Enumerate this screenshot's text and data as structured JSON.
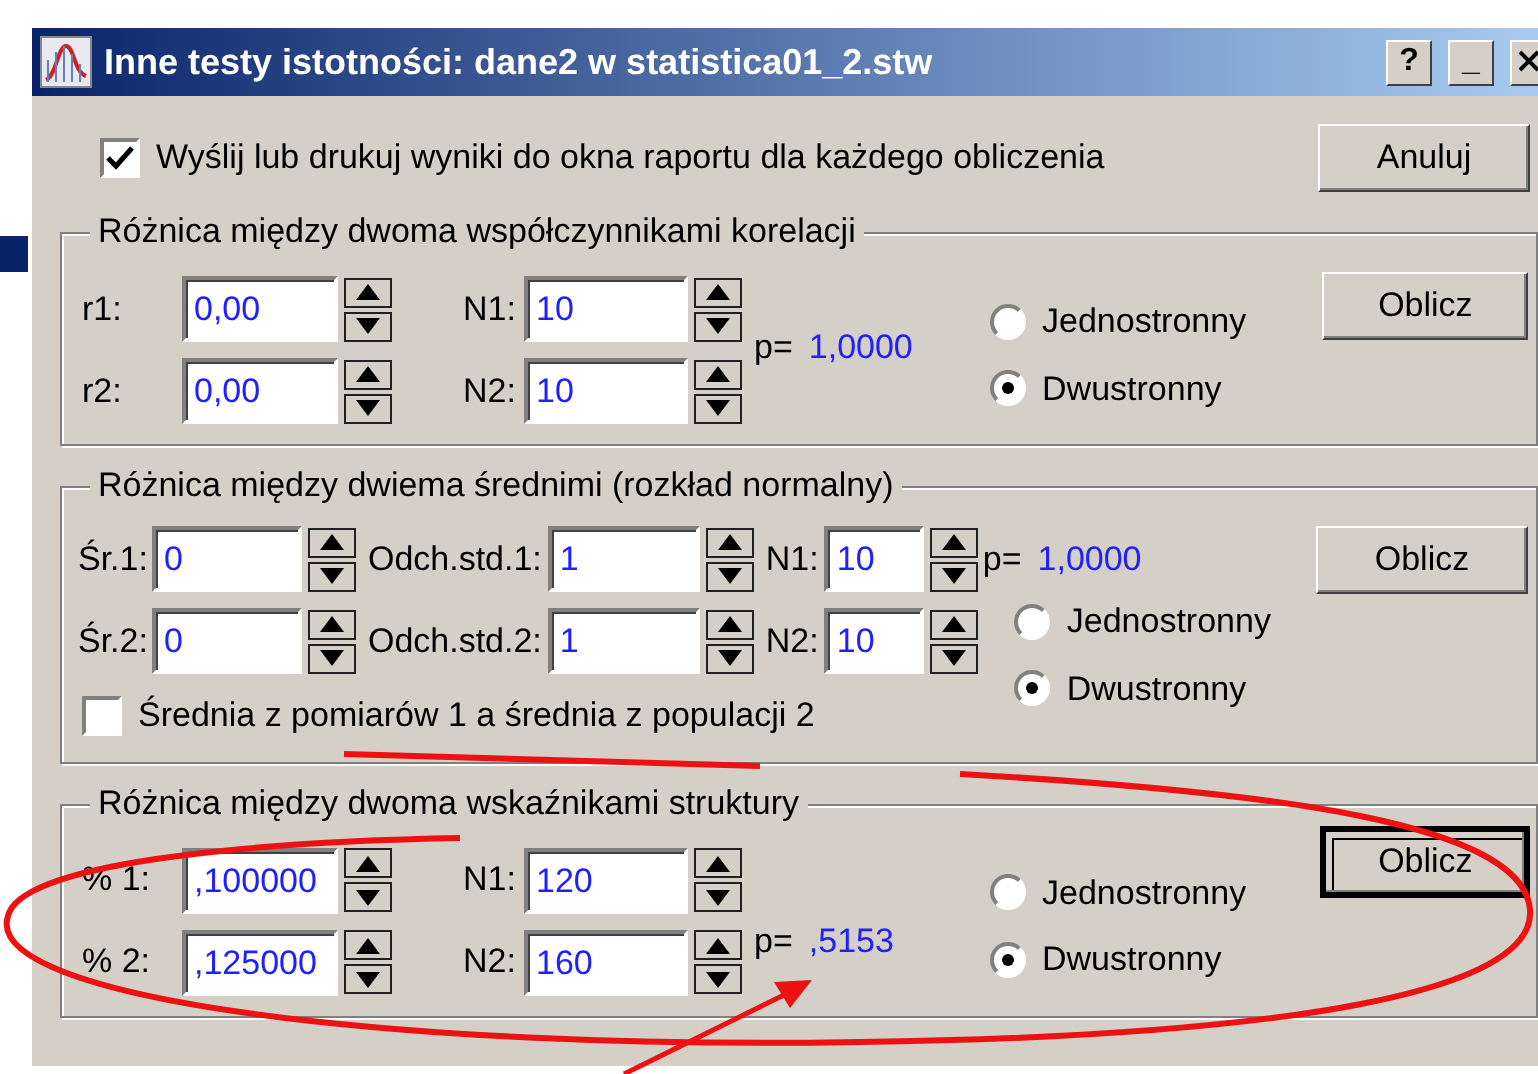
{
  "window": {
    "title": "Inne testy istotności: dane2 w statistica01_2.stw",
    "title_buttons": [
      "?",
      "_"
    ]
  },
  "report_checkbox": {
    "label": "Wyślij lub drukuj wyniki do okna raportu dla każdego obliczenia",
    "checked": true
  },
  "cancel_button": "Anuluj",
  "groups": [
    {
      "kind": "pair",
      "title": "Różnica między dwoma współczynnikami korelacji",
      "rows": [
        [
          {
            "label": "r1:",
            "value": "0,00"
          },
          {
            "label": "N1:",
            "value": "10"
          }
        ],
        [
          {
            "label": "r2:",
            "value": "0,00"
          },
          {
            "label": "N2:",
            "value": "10"
          }
        ]
      ],
      "p_label": "p=",
      "p_value": "1,0000",
      "button": {
        "label": "Oblicz",
        "focused": false
      },
      "radios": [
        {
          "label": "Jednostronny",
          "selected": false
        },
        {
          "label": "Dwustronny",
          "selected": true
        }
      ]
    },
    {
      "kind": "means",
      "title": "Różnica między dwiema średnimi (rozkład normalny)",
      "rows": [
        [
          {
            "label": "Śr.1:",
            "value": "0"
          },
          {
            "label": "Odch.std.1:",
            "value": "1"
          },
          {
            "label": "N1:",
            "value": "10"
          }
        ],
        [
          {
            "label": "Śr.2:",
            "value": "0"
          },
          {
            "label": "Odch.std.2:",
            "value": "1"
          },
          {
            "label": "N2:",
            "value": "10"
          }
        ]
      ],
      "p_label": "p=",
      "p_value": "1,0000",
      "button": {
        "label": "Oblicz",
        "focused": false
      },
      "radios": [
        {
          "label": "Jednostronny",
          "selected": false
        },
        {
          "label": "Dwustronny",
          "selected": true
        }
      ],
      "checkbox": {
        "label": "Średnia z pomiarów 1 a średnia z populacji 2",
        "checked": false
      }
    },
    {
      "kind": "pair",
      "title": "Różnica między dwoma wskaźnikami struktury",
      "rows": [
        [
          {
            "label": "% 1:",
            "value": ",100000"
          },
          {
            "label": "N1:",
            "value": "120"
          }
        ],
        [
          {
            "label": "% 2:",
            "value": ",125000"
          },
          {
            "label": "N2:",
            "value": "160"
          }
        ]
      ],
      "p_label": "p=",
      "p_value": ",5153",
      "button": {
        "label": "Oblicz",
        "focused": true
      },
      "radios": [
        {
          "label": "Jednostronny",
          "selected": false
        },
        {
          "label": "Dwustronny",
          "selected": true
        }
      ]
    }
  ]
}
